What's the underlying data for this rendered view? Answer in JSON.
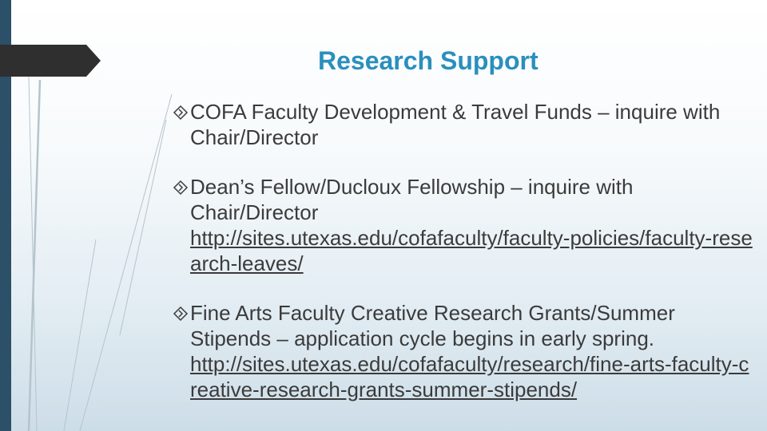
{
  "slide": {
    "title": "Research Support",
    "bullets": [
      {
        "text": "COFA Faculty Development & Travel Funds – inquire with Chair/Director",
        "link": ""
      },
      {
        "text": "Dean’s Fellow/Ducloux Fellowship – inquire with Chair/Director",
        "link": "http://sites.utexas.edu/cofafaculty/faculty-policies/faculty-research-leaves/"
      },
      {
        "text": "Fine Arts Faculty Creative Research Grants/Summer Stipends – application cycle begins in early spring.",
        "link": "http://sites.utexas.edu/cofafaculty/research/fine-arts-faculty-creative-research-grants-summer-stipends/"
      }
    ]
  },
  "colors": {
    "title": "#2a8fbd",
    "body_text": "#3b3b3b",
    "left_bar": "#2b5068",
    "title_tab": "#2f2f2f"
  },
  "icons": {
    "bullet": "diamond-arrow-icon"
  }
}
